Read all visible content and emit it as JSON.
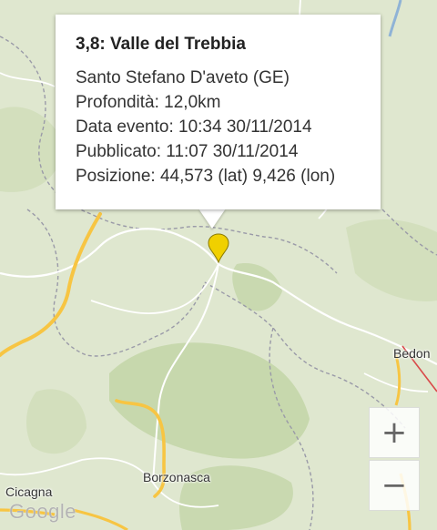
{
  "popup": {
    "title": "3,8: Valle del Trebbia",
    "lines": [
      "Santo Stefano D'aveto (GE)",
      "Profondità: 12,0km",
      "Data evento: 10:34 30/11/2014",
      "Pubblicato: 11:07 30/11/2014",
      "Posizione: 44,573 (lat) 9,426 (lon)"
    ]
  },
  "map": {
    "places": {
      "bedonia": "Bedon",
      "borzonasca": "Borzonasca",
      "cicagna": "Cicagna"
    },
    "logo": "Google",
    "marker_color": "#f0d000",
    "road_color": "#f7c543"
  },
  "zoom": {
    "in": "+",
    "out": "−"
  }
}
